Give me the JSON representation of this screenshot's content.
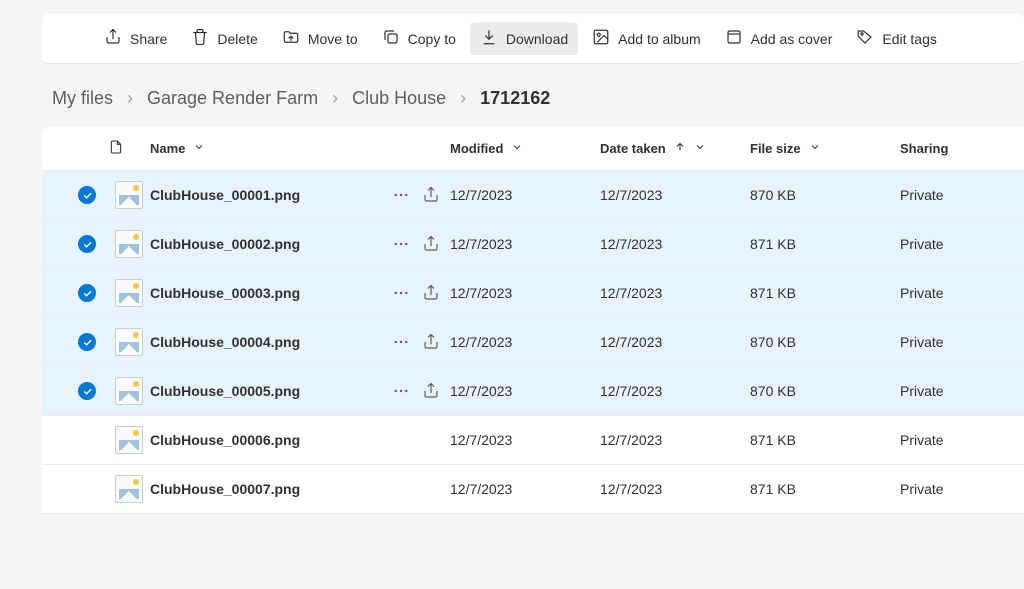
{
  "toolbar": {
    "share": "Share",
    "delete": "Delete",
    "move_to": "Move to",
    "copy_to": "Copy to",
    "download": "Download",
    "add_to_album": "Add to album",
    "add_as_cover": "Add as cover",
    "edit_tags": "Edit tags"
  },
  "breadcrumb": {
    "items": [
      "My files",
      "Garage Render Farm",
      "Club House",
      "1712162"
    ]
  },
  "columns": {
    "name": "Name",
    "modified": "Modified",
    "date_taken": "Date taken",
    "file_size": "File size",
    "sharing": "Sharing"
  },
  "files": [
    {
      "selected": true,
      "name": "ClubHouse_00001.png",
      "modified": "12/7/2023",
      "date_taken": "12/7/2023",
      "size": "870 KB",
      "sharing": "Private"
    },
    {
      "selected": true,
      "name": "ClubHouse_00002.png",
      "modified": "12/7/2023",
      "date_taken": "12/7/2023",
      "size": "871 KB",
      "sharing": "Private"
    },
    {
      "selected": true,
      "name": "ClubHouse_00003.png",
      "modified": "12/7/2023",
      "date_taken": "12/7/2023",
      "size": "871 KB",
      "sharing": "Private"
    },
    {
      "selected": true,
      "name": "ClubHouse_00004.png",
      "modified": "12/7/2023",
      "date_taken": "12/7/2023",
      "size": "870 KB",
      "sharing": "Private"
    },
    {
      "selected": true,
      "name": "ClubHouse_00005.png",
      "modified": "12/7/2023",
      "date_taken": "12/7/2023",
      "size": "870 KB",
      "sharing": "Private"
    },
    {
      "selected": false,
      "name": "ClubHouse_00006.png",
      "modified": "12/7/2023",
      "date_taken": "12/7/2023",
      "size": "871 KB",
      "sharing": "Private"
    },
    {
      "selected": false,
      "name": "ClubHouse_00007.png",
      "modified": "12/7/2023",
      "date_taken": "12/7/2023",
      "size": "871 KB",
      "sharing": "Private"
    }
  ]
}
